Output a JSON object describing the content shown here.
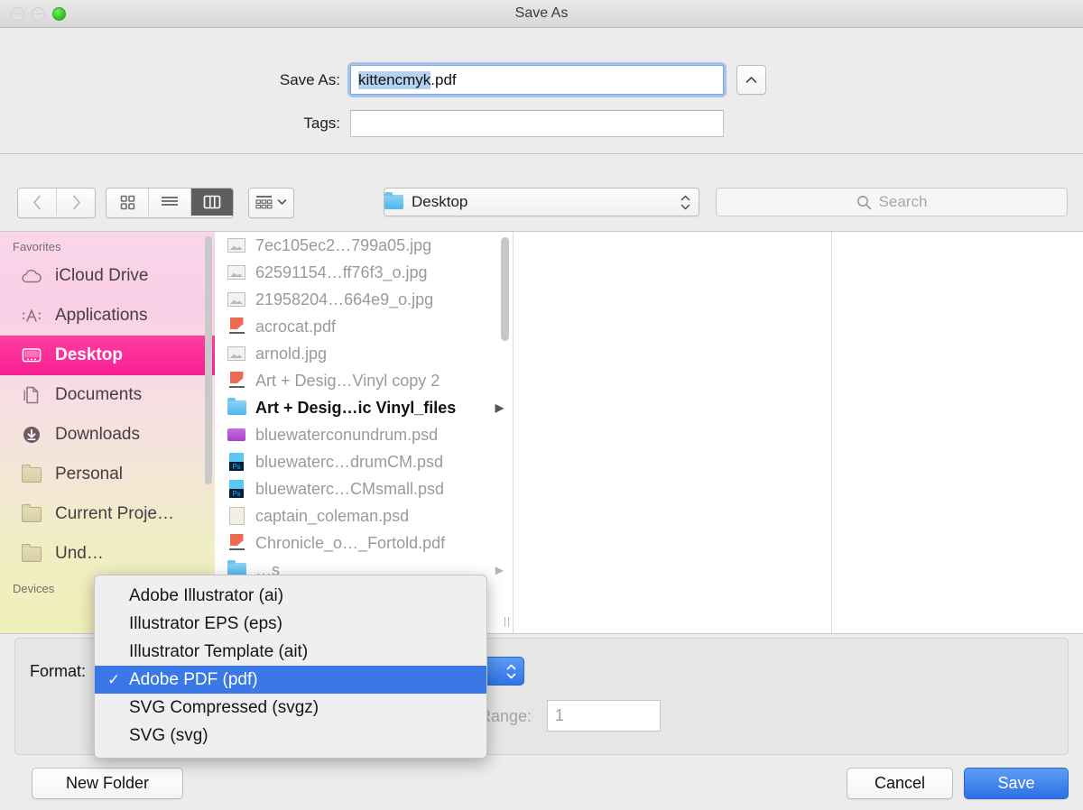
{
  "window": {
    "title": "Save As",
    "traffic_lights": [
      "close",
      "minimize",
      "zoom"
    ]
  },
  "name_area": {
    "save_as_label": "Save As:",
    "save_as_value_selected": "kittencmyk",
    "save_as_value_rest": ".pdf",
    "tags_label": "Tags:",
    "tags_value": "",
    "tags_placeholder": ""
  },
  "toolbar": {
    "back_icon": "chevron-left-icon",
    "forward_icon": "chevron-right-icon",
    "view_icon_label": "icon-view",
    "view_list_label": "list-view",
    "view_column_label": "column-view",
    "arrange_label": "arrange",
    "location_value": "Desktop",
    "search_placeholder": "Search"
  },
  "sidebar": {
    "sections": [
      {
        "header": "Favorites",
        "items": [
          {
            "label": "iCloud Drive",
            "icon": "cloud-icon",
            "selected": false
          },
          {
            "label": "Applications",
            "icon": "applications-icon",
            "selected": false
          },
          {
            "label": "Desktop",
            "icon": "desktop-icon",
            "selected": true
          },
          {
            "label": "Documents",
            "icon": "documents-icon",
            "selected": false
          },
          {
            "label": "Downloads",
            "icon": "downloads-icon",
            "selected": false
          },
          {
            "label": "Personal",
            "icon": "folder-icon",
            "selected": false
          },
          {
            "label": "Current Proje…",
            "icon": "folder-icon",
            "selected": false
          },
          {
            "label": "Und…",
            "icon": "folder-icon",
            "selected": false
          }
        ]
      },
      {
        "header": "Devices",
        "items": []
      }
    ]
  },
  "file_list": [
    {
      "name": "7ec105ec2…799a05.jpg",
      "icon": "jpg-icon",
      "enabled": false,
      "disclosure": false
    },
    {
      "name": "62591154…ff76f3_o.jpg",
      "icon": "jpg-icon",
      "enabled": false,
      "disclosure": false
    },
    {
      "name": "21958204…664e9_o.jpg",
      "icon": "jpg-icon",
      "enabled": false,
      "disclosure": false
    },
    {
      "name": "acrocat.pdf",
      "icon": "pdf-icon",
      "enabled": false,
      "disclosure": false
    },
    {
      "name": "arnold.jpg",
      "icon": "jpg-icon",
      "enabled": false,
      "disclosure": false
    },
    {
      "name": "Art + Desig…Vinyl copy 2",
      "icon": "pdf-icon",
      "enabled": false,
      "disclosure": false
    },
    {
      "name": "Art + Desig…ic Vinyl_files",
      "icon": "folder-blue-icon",
      "enabled": true,
      "disclosure": true
    },
    {
      "name": "bluewaterconundrum.psd",
      "icon": "psd-purple-icon",
      "enabled": false,
      "disclosure": false
    },
    {
      "name": "bluewaterc…drumCM.psd",
      "icon": "psd-ps-icon",
      "enabled": false,
      "disclosure": false
    },
    {
      "name": "bluewaterc…CMsmall.psd",
      "icon": "psd-ps-icon",
      "enabled": false,
      "disclosure": false
    },
    {
      "name": "captain_coleman.psd",
      "icon": "plain-icon",
      "enabled": false,
      "disclosure": false
    },
    {
      "name": "Chronicle_o…_Fortold.pdf",
      "icon": "pdf-icon",
      "enabled": false,
      "disclosure": false
    },
    {
      "name": "…s",
      "icon": "folder-blue-icon",
      "enabled": false,
      "disclosure": true
    }
  ],
  "format_bar": {
    "format_label": "Format:",
    "format_value": "Adobe PDF (pdf)",
    "range_label": "Range:",
    "range_value": "1"
  },
  "format_menu": {
    "items": [
      {
        "label": "Adobe Illustrator (ai)",
        "checked": false,
        "selected": false
      },
      {
        "label": "Illustrator EPS (eps)",
        "checked": false,
        "selected": false
      },
      {
        "label": "Illustrator Template (ait)",
        "checked": false,
        "selected": false
      },
      {
        "label": "Adobe PDF (pdf)",
        "checked": true,
        "selected": true
      },
      {
        "label": "SVG Compressed (svgz)",
        "checked": false,
        "selected": false
      },
      {
        "label": "SVG (svg)",
        "checked": false,
        "selected": false
      }
    ],
    "check_glyph": "✓"
  },
  "buttons": {
    "new_folder": "New Folder",
    "cancel": "Cancel",
    "save": "Save"
  },
  "colors": {
    "accent_blue": "#3b78e7",
    "save_button_blue": "#2f74e8",
    "sidebar_selected_pink": "#f81f93",
    "selection_highlight": "#b4d2f2"
  }
}
